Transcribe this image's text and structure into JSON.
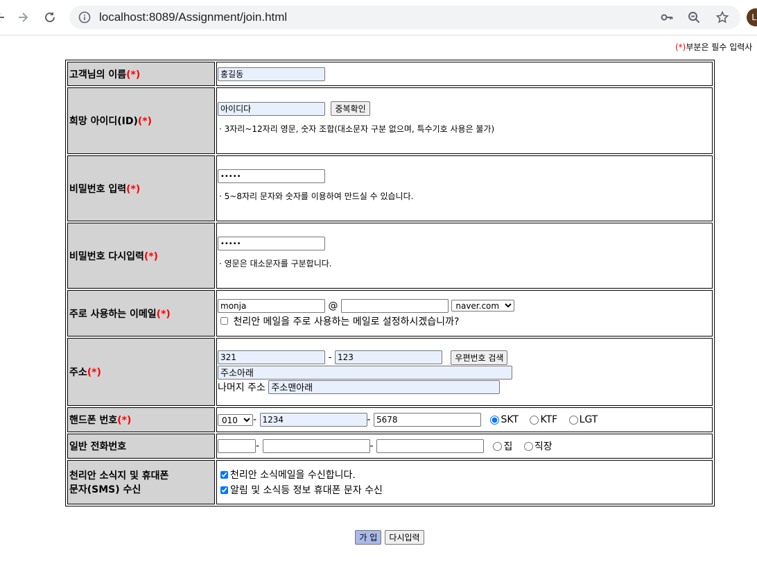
{
  "browser": {
    "url": "localhost:8089/Assignment/join.html",
    "avatar_initial": "L"
  },
  "note": {
    "marker": "(*)",
    "text": "부분은 필수 입력사"
  },
  "required_marker": "(*)",
  "rows": {
    "name": {
      "label": "고객님의 이름",
      "value": "홍길동"
    },
    "userid": {
      "label": "희망 아이디(ID)",
      "value": "아이디다",
      "check_button": "중복확인",
      "hint": "· 3자리~12자리 영문, 숫자 조합(대소문자 구분 없으며, 특수기호 사용은 불가)"
    },
    "password": {
      "label": "비밀번호 입력",
      "value": "•••••",
      "hint": "· 5~8자리 문자와 숫자를 이용하여 만드실 수 있습니다."
    },
    "password2": {
      "label": "비밀번호 다시입력",
      "value": "•••••",
      "hint": "· 영문은 대소문자를 구분합니다."
    },
    "email": {
      "label": "주로 사용하는 이메일",
      "user": "monja",
      "at": "@",
      "domain": "",
      "select": "naver.com",
      "checkbox_label": "천리안 메일을 주로 사용하는 메일로 설정하시겠습니까?"
    },
    "address": {
      "label": "주소",
      "zip1": "321",
      "dash": "-",
      "zip2": "123",
      "search_button": "우편번호 검색",
      "addr1": "주소아래",
      "rest_label": "나머지 주소",
      "addr2": "주소맨아래"
    },
    "mobile": {
      "label": "핸드폰 번호",
      "prefix": "010",
      "dash": "-",
      "mid": "1234",
      "last": "5678",
      "carriers": [
        "SKT",
        "KTF",
        "LGT"
      ]
    },
    "phone": {
      "label": "일반 전화번호",
      "dash": "-",
      "options": [
        "집",
        "직장"
      ]
    },
    "subscribe": {
      "label_line1": "천리안 소식지 및 휴대폰",
      "label_line2": "문자(SMS) 수신",
      "opt1": "천리안 소식메일을 수신합니다.",
      "opt2": "알림 및 소식등 정보 휴대폰 문자 수신"
    }
  },
  "buttons": {
    "submit": "가 입",
    "reset": "다시입력"
  }
}
